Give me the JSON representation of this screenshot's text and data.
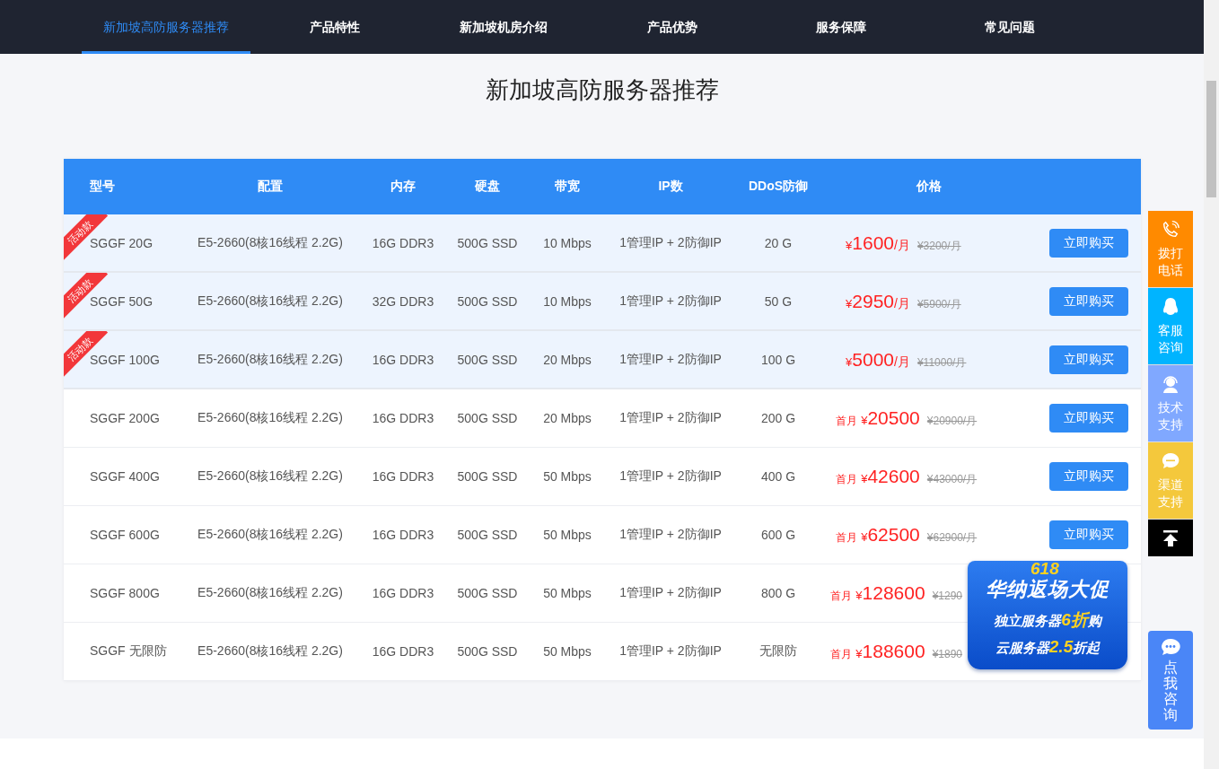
{
  "nav": {
    "tabs": [
      {
        "label": "新加坡高防服务器推荐",
        "selected": true
      },
      {
        "label": "产品特性",
        "selected": false
      },
      {
        "label": "新加坡机房介绍",
        "selected": false
      },
      {
        "label": "产品优势",
        "selected": false
      },
      {
        "label": "服务保障",
        "selected": false
      },
      {
        "label": "常见问题",
        "selected": false
      }
    ]
  },
  "title": "新加坡高防服务器推荐",
  "table": {
    "columns": [
      "型号",
      "配置",
      "内存",
      "硬盘",
      "带宽",
      "IP数",
      "DDoS防御",
      "价格"
    ],
    "rows": [
      {
        "promo": true,
        "ribbon": "活动款",
        "model": "SGGF 20G",
        "config": "E5-2660(8核16线程 2.2G)",
        "memory": "16G DDR3",
        "disk": "500G SSD",
        "bandwidth": "10 Mbps",
        "ip": "1管理IP + 2防御IP",
        "ddos": "20 G",
        "kind": "monthly",
        "currency": "¥",
        "price": "1600",
        "unit": "/月",
        "old_price": "¥3200/月",
        "button": "立即购买"
      },
      {
        "promo": true,
        "ribbon": "活动款",
        "model": "SGGF 50G",
        "config": "E5-2660(8核16线程 2.2G)",
        "memory": "32G DDR3",
        "disk": "500G SSD",
        "bandwidth": "10 Mbps",
        "ip": "1管理IP + 2防御IP",
        "ddos": "50 G",
        "kind": "monthly",
        "currency": "¥",
        "price": "2950",
        "unit": "/月",
        "old_price": "¥5900/月",
        "button": "立即购买"
      },
      {
        "promo": true,
        "ribbon": "活动款",
        "model": "SGGF 100G",
        "config": "E5-2660(8核16线程 2.2G)",
        "memory": "16G DDR3",
        "disk": "500G SSD",
        "bandwidth": "20 Mbps",
        "ip": "1管理IP + 2防御IP",
        "ddos": "100 G",
        "kind": "monthly",
        "currency": "¥",
        "price": "5000",
        "unit": "/月",
        "old_price": "¥11000/月",
        "button": "立即购买"
      },
      {
        "promo": false,
        "model": "SGGF 200G",
        "config": "E5-2660(8核16线程 2.2G)",
        "memory": "16G DDR3",
        "disk": "500G SSD",
        "bandwidth": "20 Mbps",
        "ip": "1管理IP + 2防御IP",
        "ddos": "200 G",
        "kind": "first_month",
        "prefix": "首月",
        "currency": "¥",
        "price": "20500",
        "old_price": "¥20900/月",
        "button": "立即购买"
      },
      {
        "promo": false,
        "model": "SGGF 400G",
        "config": "E5-2660(8核16线程 2.2G)",
        "memory": "16G DDR3",
        "disk": "500G SSD",
        "bandwidth": "50 Mbps",
        "ip": "1管理IP + 2防御IP",
        "ddos": "400 G",
        "kind": "first_month",
        "prefix": "首月",
        "currency": "¥",
        "price": "42600",
        "old_price": "¥43000/月",
        "button": "立即购买"
      },
      {
        "promo": false,
        "model": "SGGF 600G",
        "config": "E5-2660(8核16线程 2.2G)",
        "memory": "16G DDR3",
        "disk": "500G SSD",
        "bandwidth": "50 Mbps",
        "ip": "1管理IP + 2防御IP",
        "ddos": "600 G",
        "kind": "first_month",
        "prefix": "首月",
        "currency": "¥",
        "price": "62500",
        "old_price": "¥62900/月",
        "button": "立即购买"
      },
      {
        "promo": false,
        "model": "SGGF 800G",
        "config": "E5-2660(8核16线程 2.2G)",
        "memory": "16G DDR3",
        "disk": "500G SSD",
        "bandwidth": "50 Mbps",
        "ip": "1管理IP + 2防御IP",
        "ddos": "800 G",
        "kind": "first_month",
        "prefix": "首月",
        "currency": "¥",
        "price": "128600",
        "old_price": "¥1290"
      },
      {
        "promo": false,
        "model": "SGGF 无限防",
        "config": "E5-2660(8核16线程 2.2G)",
        "memory": "16G DDR3",
        "disk": "500G SSD",
        "bandwidth": "50 Mbps",
        "ip": "1管理IP + 2防御IP",
        "ddos": "无限防",
        "kind": "first_month",
        "prefix": "首月",
        "currency": "¥",
        "price": "188600",
        "old_price": "¥1890"
      }
    ]
  },
  "promo_banner": {
    "badge": "618",
    "title": "华纳返场大促",
    "lines": [
      {
        "before": "独立服务器",
        "highlight": "6折",
        "after": "购"
      },
      {
        "before": "云服务器",
        "highlight": "2.5",
        "after": "折起"
      }
    ]
  },
  "side_bar": {
    "items": [
      {
        "kind": "phone",
        "label": "拨打电话",
        "color": "#ff8a00"
      },
      {
        "kind": "service",
        "label": "客服咨询",
        "color": "#00b4ff"
      },
      {
        "kind": "support",
        "label": "技术支持",
        "color": "#80a8ff"
      },
      {
        "kind": "chat",
        "label": "渠道支持",
        "color": "#f4c83c"
      }
    ]
  },
  "consult_button": {
    "label": "点我咨询"
  }
}
